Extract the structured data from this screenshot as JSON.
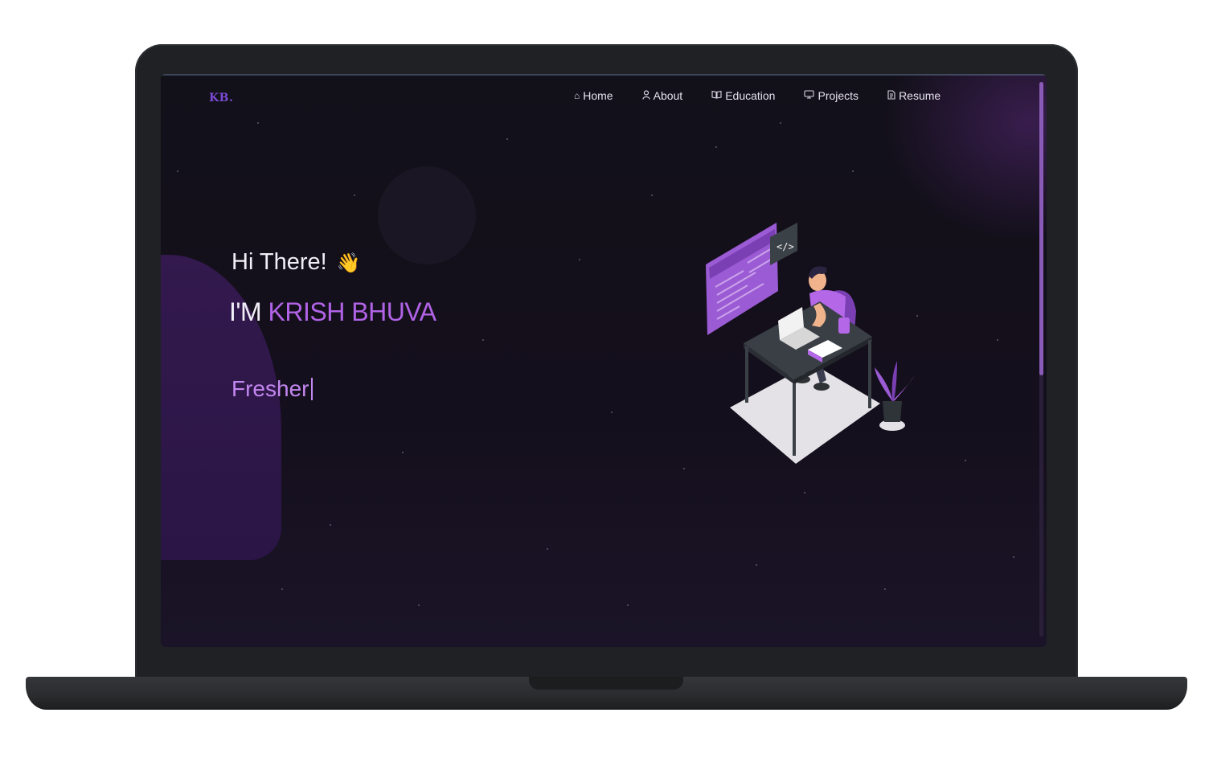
{
  "nav": {
    "logo": "KB.",
    "items": [
      {
        "label": "Home",
        "icon": "home-icon"
      },
      {
        "label": "About",
        "icon": "user-icon"
      },
      {
        "label": "Education",
        "icon": "book-icon"
      },
      {
        "label": "Projects",
        "icon": "projects-icon"
      },
      {
        "label": "Resume",
        "icon": "document-icon"
      }
    ]
  },
  "hero": {
    "greeting": "Hi There!",
    "greeting_emoji": "👋",
    "intro_prefix": "I'M ",
    "name": "KRISH BHUVA",
    "typed_text": "Fresher"
  },
  "colors": {
    "accent": "#b163e6",
    "background": "#121019",
    "logo": "#7c4bd6"
  }
}
